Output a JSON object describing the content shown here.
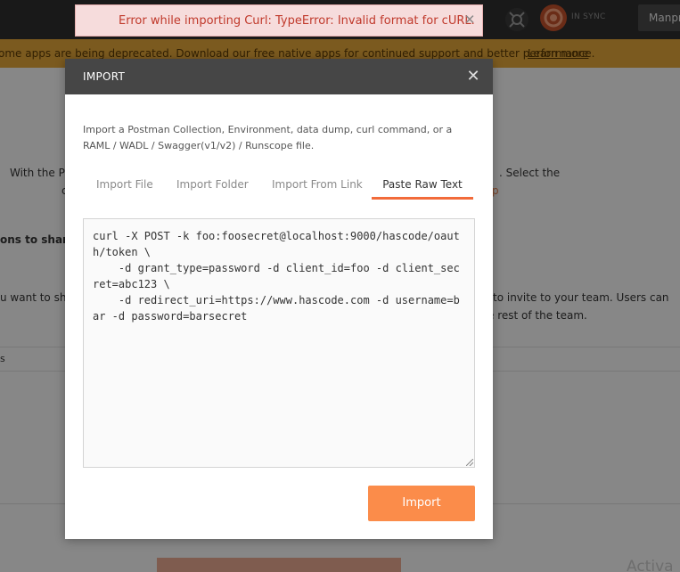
{
  "topbar": {
    "sync_label": "IN SYNC",
    "user_label": "Manpr"
  },
  "banner": {
    "message": "ome apps are being deprecated. Download our free native apps for continued support and better performance.",
    "link": "Learn more"
  },
  "background": {
    "line1_left": "With the Po",
    "line1_right": ". Select the",
    "line2_left": "c",
    "line2_right": "p",
    "heading_left": "ons to share",
    "line3_left": "u want to sh",
    "line3_right": "to invite to your team. Users can",
    "line4_right": "e rest of the team.",
    "table_left": "s",
    "watermark": "Activa"
  },
  "toast": {
    "message": "Error while importing Curl: TypeError: Invalid format for cURL.",
    "close": "✕"
  },
  "modal": {
    "title": "IMPORT",
    "close": "✕",
    "description": "Import a Postman Collection, Environment, data dump, curl command, or a RAML / WADL / Swagger(v1/v2) / Runscope file.",
    "tabs": [
      {
        "label": "Import File"
      },
      {
        "label": "Import Folder"
      },
      {
        "label": "Import From Link"
      },
      {
        "label": "Paste Raw Text"
      }
    ],
    "raw_text": "curl -X POST -k foo:foosecret@localhost:9000/hascode/oauth/token \\\n    -d grant_type=password -d client_id=foo -d client_secret=abc123 \\\n    -d redirect_uri=https://www.hascode.com -d username=bar -d password=barsecret",
    "import_button": "Import"
  },
  "colors": {
    "accent": "#f26b3a",
    "button": "#fb8c4a",
    "toast_text": "#c0392b",
    "toast_bg": "#f6dcdc"
  }
}
